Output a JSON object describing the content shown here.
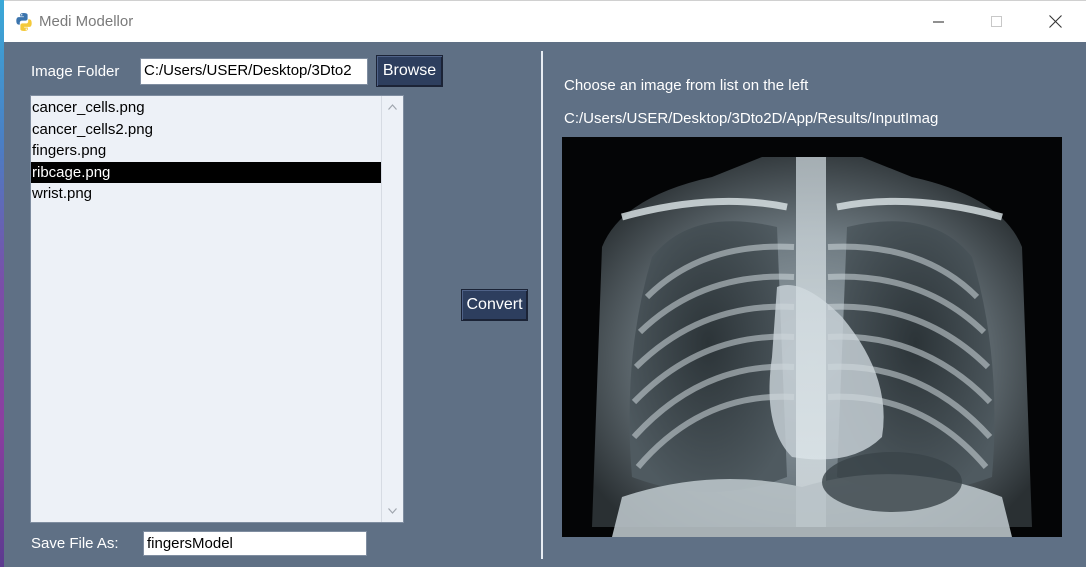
{
  "window": {
    "title": "Medi Modellor"
  },
  "image_folder": {
    "label": "Image Folder",
    "path_value": "C:/Users/USER/Desktop/3Dto2",
    "browse_label": "Browse"
  },
  "file_list": {
    "items": [
      {
        "name": "cancer_cells.png",
        "selected": false
      },
      {
        "name": "cancer_cells2.png",
        "selected": false
      },
      {
        "name": "fingers.png",
        "selected": false
      },
      {
        "name": "ribcage.png",
        "selected": true
      },
      {
        "name": "wrist.png",
        "selected": false
      }
    ]
  },
  "save": {
    "label": "Save File As:",
    "value": "fingersModel"
  },
  "convert": {
    "label": "Convert"
  },
  "preview": {
    "instruction": "Choose an image from list on the left",
    "path": "C:/Users/USER/Desktop/3Dto2D/App/Results/InputImag"
  },
  "icons": {
    "app": "python-icon",
    "minimize": "minimize-icon",
    "maximize": "maximize-icon",
    "close": "close-icon",
    "scroll_up": "chevron-up-icon",
    "scroll_down": "chevron-down-icon"
  },
  "colors": {
    "window_bg": "#5f7085",
    "button_bg": "#2d3e5e",
    "listbox_bg": "#edf1f7",
    "selection_bg": "#000000"
  }
}
